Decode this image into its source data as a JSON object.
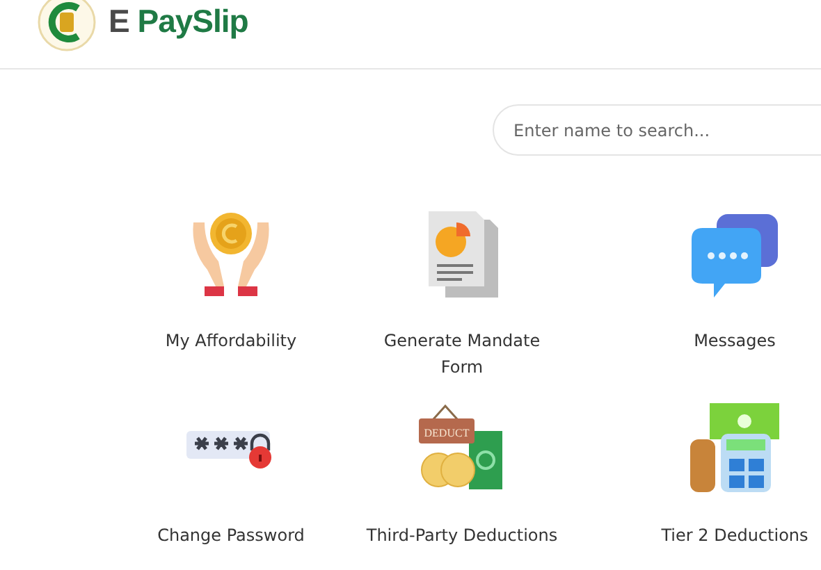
{
  "brand": {
    "prefix": "E",
    "name": "PaySlip"
  },
  "search": {
    "placeholder": "Enter name to search..."
  },
  "tiles": [
    {
      "kind": "affordability",
      "label": "My Affordability"
    },
    {
      "kind": "mandate",
      "label": "Generate Mandate Form"
    },
    {
      "kind": "messages",
      "label": "Messages"
    },
    {
      "kind": "password",
      "label": "Change Password"
    },
    {
      "kind": "deductions",
      "label": "Third-Party Deductions",
      "sign": "DEDUCT"
    },
    {
      "kind": "tier",
      "label": "Tier 2 Deductions"
    }
  ]
}
